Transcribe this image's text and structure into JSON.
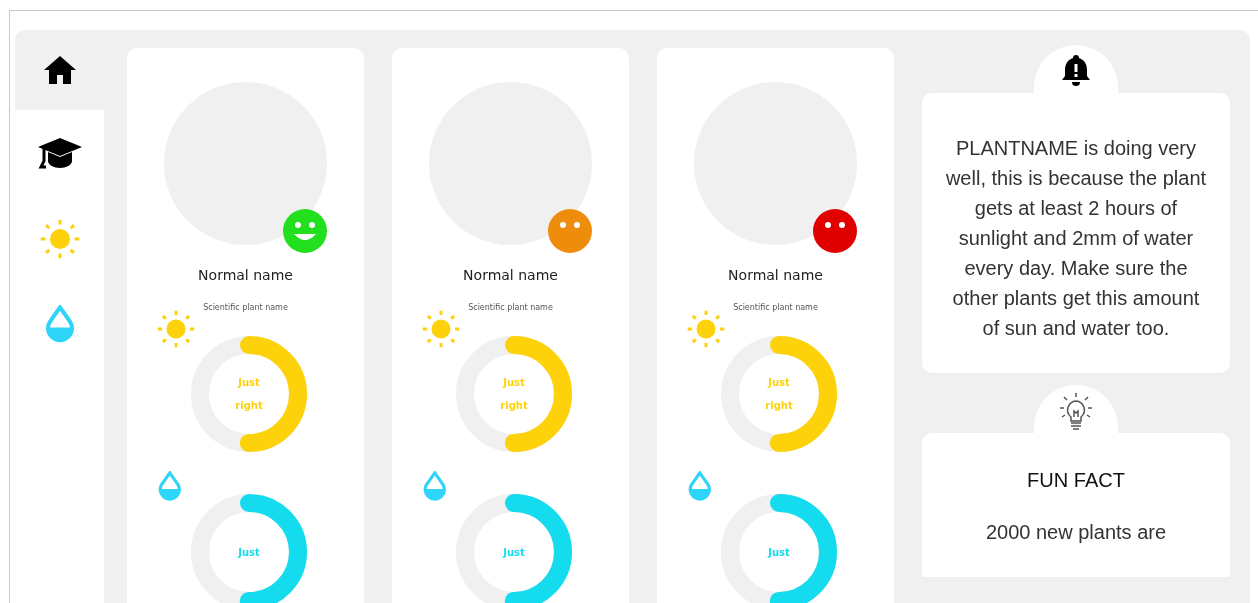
{
  "sidebar": {
    "items": [
      {
        "kind": "home",
        "selected": true
      },
      {
        "kind": "education",
        "selected": false
      },
      {
        "kind": "sun",
        "selected": false
      },
      {
        "kind": "water",
        "selected": false
      }
    ]
  },
  "plants": [
    {
      "name": "Normal name",
      "scientific_name": "Scientific plant name",
      "mood": {
        "kind": "happy",
        "color": "#22e01e"
      },
      "gauges": [
        {
          "kind": "sun",
          "level": 0.5,
          "label_lines": [
            "Just",
            "right"
          ]
        },
        {
          "kind": "water",
          "level": 0.5,
          "label_lines": [
            "Just"
          ]
        }
      ]
    },
    {
      "name": "Normal name",
      "scientific_name": "Scientific plant name",
      "mood": {
        "kind": "plain",
        "color": "#ee8c0c"
      },
      "gauges": [
        {
          "kind": "sun",
          "level": 0.5,
          "label_lines": [
            "Just",
            "right"
          ]
        },
        {
          "kind": "water",
          "level": 0.5,
          "label_lines": [
            "Just"
          ]
        }
      ]
    },
    {
      "name": "Normal name",
      "scientific_name": "Scientific plant name",
      "mood": {
        "kind": "plain",
        "color": "#e00000"
      },
      "gauges": [
        {
          "kind": "sun",
          "level": 0.5,
          "label_lines": [
            "Just",
            "right"
          ]
        },
        {
          "kind": "water",
          "level": 0.5,
          "label_lines": [
            "Just"
          ]
        }
      ]
    }
  ],
  "alert": {
    "text": "PLANTNAME is doing very well, this is because the plant gets at least 2 hours of sunlight and 2mm of water every day. Make sure the other plants get this amount of sun and water too."
  },
  "fun_fact": {
    "title": "FUN FACT",
    "text": "2000 new plants are"
  }
}
